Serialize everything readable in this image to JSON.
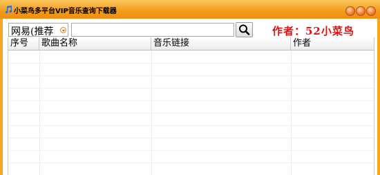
{
  "window": {
    "title": "小菜鸟多平台VIP音乐查询下载器",
    "icon": "music-note-icon",
    "accent": "#f39a1a"
  },
  "toolbar": {
    "platform_selected": "网易(推荐",
    "search_value": "",
    "search_icon": "magnifier-icon",
    "author_text": "作者：52小菜鸟",
    "author_color": "#e01010"
  },
  "table": {
    "columns": [
      "序号",
      "歌曲名称",
      "音乐链接",
      "作者"
    ],
    "rows": []
  }
}
